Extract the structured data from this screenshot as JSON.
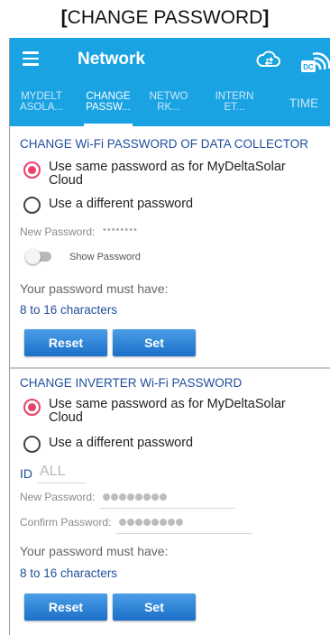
{
  "caption": {
    "open": "[",
    "text": "CHANGE PASSWORD",
    "close": "]"
  },
  "appbar": {
    "title": "Network",
    "menu_icon": "hamburger-menu-icon",
    "cloud_icon": "cloud-sync-icon",
    "dc_icon": "data-collector-wifi-icon",
    "dc_badge": "DC",
    "color": "#1aa3e2"
  },
  "tabs": [
    {
      "label_line1": "MYDELT",
      "label_line2": "ASOLA..."
    },
    {
      "label_line1": "CHANGE",
      "label_line2": "PASSW..."
    },
    {
      "label_line1": "NETWO",
      "label_line2": "RK..."
    },
    {
      "label_line1": "INTERN",
      "label_line2": "ET..."
    },
    {
      "label_line1": "TIME",
      "label_line2": ""
    }
  ],
  "active_tab": "CHANGE PASSW...",
  "collector": {
    "title": "CHANGE Wi-Fi PASSWORD OF DATA COLLECTOR",
    "option_same_line1": "Use same password as for MyDeltaSolar",
    "option_same_line2": "Cloud",
    "option_diff": "Use a different password",
    "new_password_label": "New Password:",
    "new_password_value": "••••••••",
    "show_password_label": "Show Password",
    "must_have": "Your password must have:",
    "rule": "8 to 16 characters",
    "reset_label": "Reset",
    "set_label": "Set"
  },
  "inverter": {
    "title": "CHANGE INVERTER Wi-Fi PASSWORD",
    "option_same_line1": "Use same password as for MyDeltaSolar",
    "option_same_line2": "Cloud",
    "option_diff": "Use a different password",
    "id_label": "ID",
    "id_value": "ALL",
    "new_password_label": "New Password:",
    "confirm_password_label": "Confirm Password:",
    "must_have": "Your password must have:",
    "rule": "8 to 16 characters",
    "reset_label": "Reset",
    "set_label": "Set"
  },
  "colors": {
    "accent": "#1aa3e2",
    "radio_selected": "#e8416e",
    "link_text": "#1f4e9c",
    "button": "#2a7fd6"
  }
}
